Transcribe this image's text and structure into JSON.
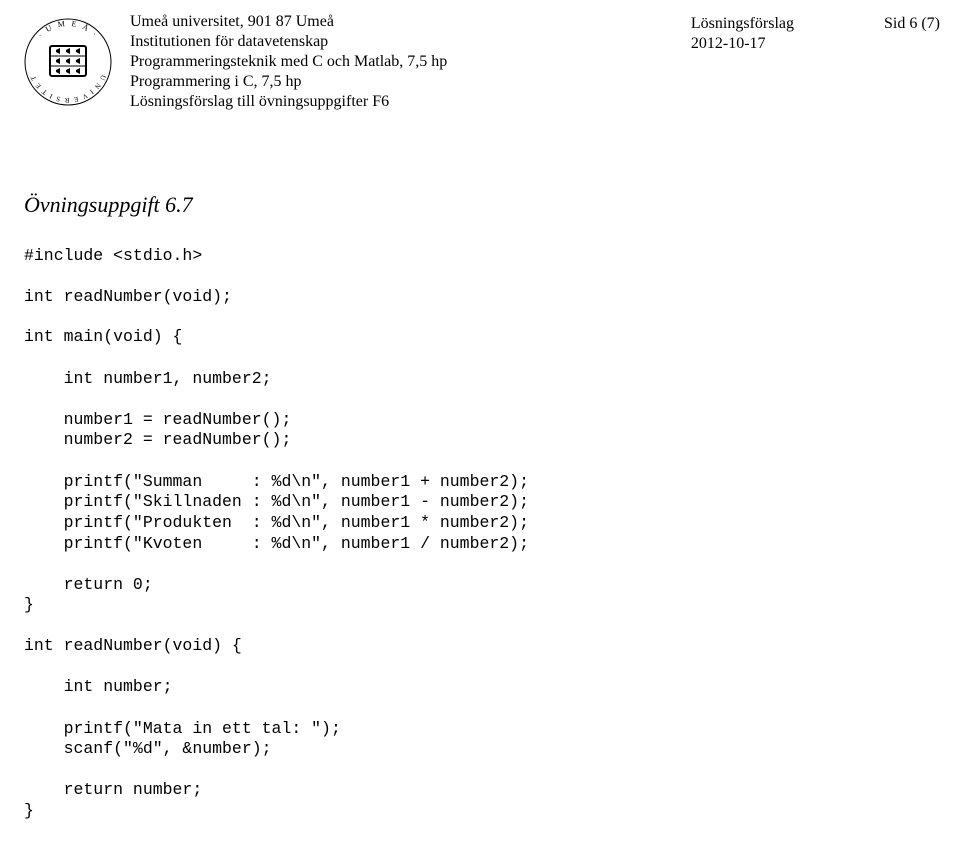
{
  "header": {
    "university": "Umeå universitet, 901 87 Umeå",
    "department": "Institutionen för datavetenskap",
    "course1": "Programmeringsteknik med C och Matlab, 7,5 hp",
    "course2": "Programmering i C, 7,5 hp",
    "subtitle": "Lösningsförslag till övningsuppgifter F6",
    "doc_type": "Lösningsförslag",
    "date": "2012-10-17",
    "page_label": "Sid 6 (7)"
  },
  "exercise": {
    "title": "Övningsuppgift 6.7",
    "code_block1": "#include <stdio.h>",
    "code_block2": "int readNumber(void);",
    "code_block3": "int main(void) {\n\n    int number1, number2;\n\n    number1 = readNumber();\n    number2 = readNumber();\n\n    printf(\"Summan     : %d\\n\", number1 + number2);\n    printf(\"Skillnaden : %d\\n\", number1 - number2);\n    printf(\"Produkten  : %d\\n\", number1 * number2);\n    printf(\"Kvoten     : %d\\n\", number1 / number2);\n\n    return 0;\n}",
    "code_block4": "int readNumber(void) {\n\n    int number;\n\n    printf(\"Mata in ett tal: \");\n    scanf(\"%d\", &number);\n\n    return number;\n}"
  }
}
